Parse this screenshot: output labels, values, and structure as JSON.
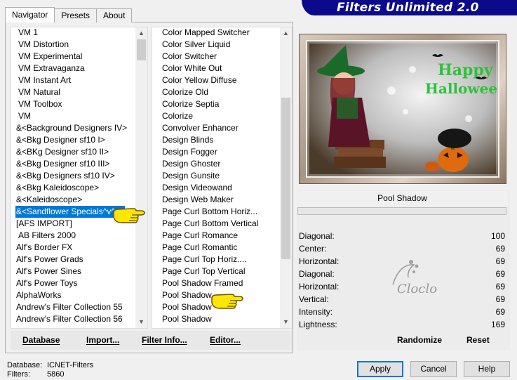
{
  "tabs": [
    "Navigator",
    "Presets",
    "About"
  ],
  "banner_title": "Filters Unlimited 2.0",
  "left_list": [
    "VM 1",
    "VM Distortion",
    "VM Experimental",
    "VM Extravaganza",
    "VM Instant Art",
    "VM Natural",
    "VM Toolbox",
    "VM",
    "&<Background Designers IV>",
    "&<Bkg Designer sf10 I>",
    "&<BKg Designer sf10 II>",
    "&<Bkg Designer sf10 III>",
    "&<Bkg Designers sf10 IV>",
    "&<Bkg Kaleidoscope>",
    "&<Kaleidoscope>",
    "&<Sandflower Specials^v^ >",
    "[AFS IMPORT]",
    "AB Filters 2000",
    "Alf's Border FX",
    "Alf's Power Grads",
    "Alf's Power Sines",
    "Alf's Power Toys",
    "AlphaWorks",
    "Andrew's Filter Collection 55",
    "Andrew's Filter Collection 56"
  ],
  "left_selected_index": 15,
  "right_list": [
    "Color Mapped Switcher",
    "Color Silver Liquid",
    "Color Switcher",
    "Color White Out",
    "Color Yellow Diffuse",
    "Colorize Old",
    "Colorize Septia",
    "Colorize",
    "Convolver Enhancer",
    "Design Blinds",
    "Design Fogger",
    "Design Ghoster",
    "Design Gunsite",
    "Design Videowand",
    "Design Web Maker",
    "Page Curl Bottom Horiz...",
    "Page Curl Bottom Vertical",
    "Page Curl Romance",
    "Page Curl Romantic",
    "Page Curl Top Horiz....",
    "Page Curl Top Vertical",
    "Pool Shadow Framed",
    "Pool Shadow",
    "Pool Shadow",
    "Pool Shadow"
  ],
  "left_buttons": [
    "Database",
    "Import...",
    "Filter Info...",
    "Editor..."
  ],
  "filter_name": "Pool Shadow",
  "params": [
    {
      "label": "Diagonal:",
      "value": "100"
    },
    {
      "label": "Center:",
      "value": "69"
    },
    {
      "label": "Horizontal:",
      "value": "69"
    },
    {
      "label": "Diagonal:",
      "value": "69"
    },
    {
      "label": "Horizontal:",
      "value": "69"
    },
    {
      "label": "Vertical:",
      "value": "69"
    },
    {
      "label": "Intensity:",
      "value": "69"
    },
    {
      "label": "Lightness:",
      "value": "169"
    }
  ],
  "preview_text": [
    "Happy",
    "Halloween"
  ],
  "watermark_text": "Cloclo",
  "right_buttons": [
    "Randomize",
    "Reset"
  ],
  "footer": {
    "database_label": "Database:",
    "database_value": "ICNET-Filters",
    "filters_label": "Filters:",
    "filters_value": "5860"
  },
  "dialog_buttons": [
    "Apply",
    "Cancel",
    "Help"
  ],
  "colors": {
    "banner": "#0a0a8a",
    "selection": "#0078d7"
  }
}
